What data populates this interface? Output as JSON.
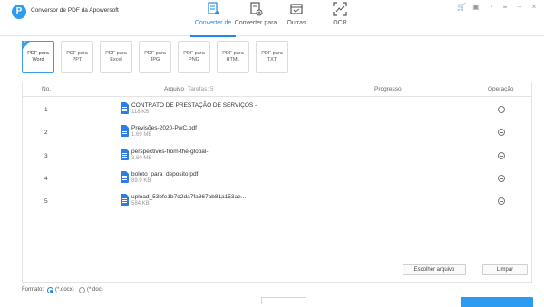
{
  "app": {
    "title": "Conversor de PDF da Apowersoft",
    "logo_glyph": "P"
  },
  "main_tabs": [
    {
      "label": "Converter de",
      "icon": "convert-from-icon",
      "active": true
    },
    {
      "label": "Converter para",
      "icon": "convert-to-icon",
      "active": false
    },
    {
      "label": "Outras",
      "icon": "tools-icon",
      "active": false
    },
    {
      "label": "OCR",
      "icon": "ocr-scan-icon",
      "active": false
    }
  ],
  "window_controls": [
    "cart-icon",
    "gift-icon",
    "bell-icon",
    "menu-icon",
    "minimize-icon",
    "close-icon"
  ],
  "sub_tiles": [
    {
      "line1": "PDF para",
      "line2": "Word",
      "active": true
    },
    {
      "line1": "PDF para",
      "line2": "PPT",
      "active": false
    },
    {
      "line1": "PDF para",
      "line2": "Excel",
      "active": false
    },
    {
      "line1": "PDF para",
      "line2": "JPG",
      "active": false
    },
    {
      "line1": "PDF para",
      "line2": "PNG",
      "active": false
    },
    {
      "line1": "PDF para",
      "line2": "HTML",
      "active": false
    },
    {
      "line1": "PDF para",
      "line2": "TXT",
      "active": false
    }
  ],
  "table": {
    "col_no": "No.",
    "col_file": "Arquivo",
    "tasks_label": "Tarefas: 5",
    "col_progress": "Progresso",
    "col_operation": "Operação",
    "rows": [
      {
        "no": "1",
        "name": "CONTRATO DE PRESTAÇÃO DE SERVIÇOS -",
        "size": "118 KB"
      },
      {
        "no": "2",
        "name": "Previsões-2020-PwC.pdf",
        "size": "1.69 MB"
      },
      {
        "no": "3",
        "name": "perspectives-from-the-global-",
        "size": "3.60 MB"
      },
      {
        "no": "4",
        "name": "boleto_para_deposito.pdf",
        "size": "89.9 KB"
      },
      {
        "no": "5",
        "name": "upload_53bfe1b7d2da7fa867ab81a153ae...",
        "size": "584 KB"
      }
    ]
  },
  "buttons": {
    "choose_file": "Escolher arquivo",
    "clear": "Limpar"
  },
  "footer": {
    "format_label": "Formato:",
    "opt_docx": "(*.docx)",
    "opt_doc": "(*.doc)",
    "selected": "docx"
  },
  "colors": {
    "accent": "#1e88e5",
    "file_icon": "#2f7de1"
  }
}
